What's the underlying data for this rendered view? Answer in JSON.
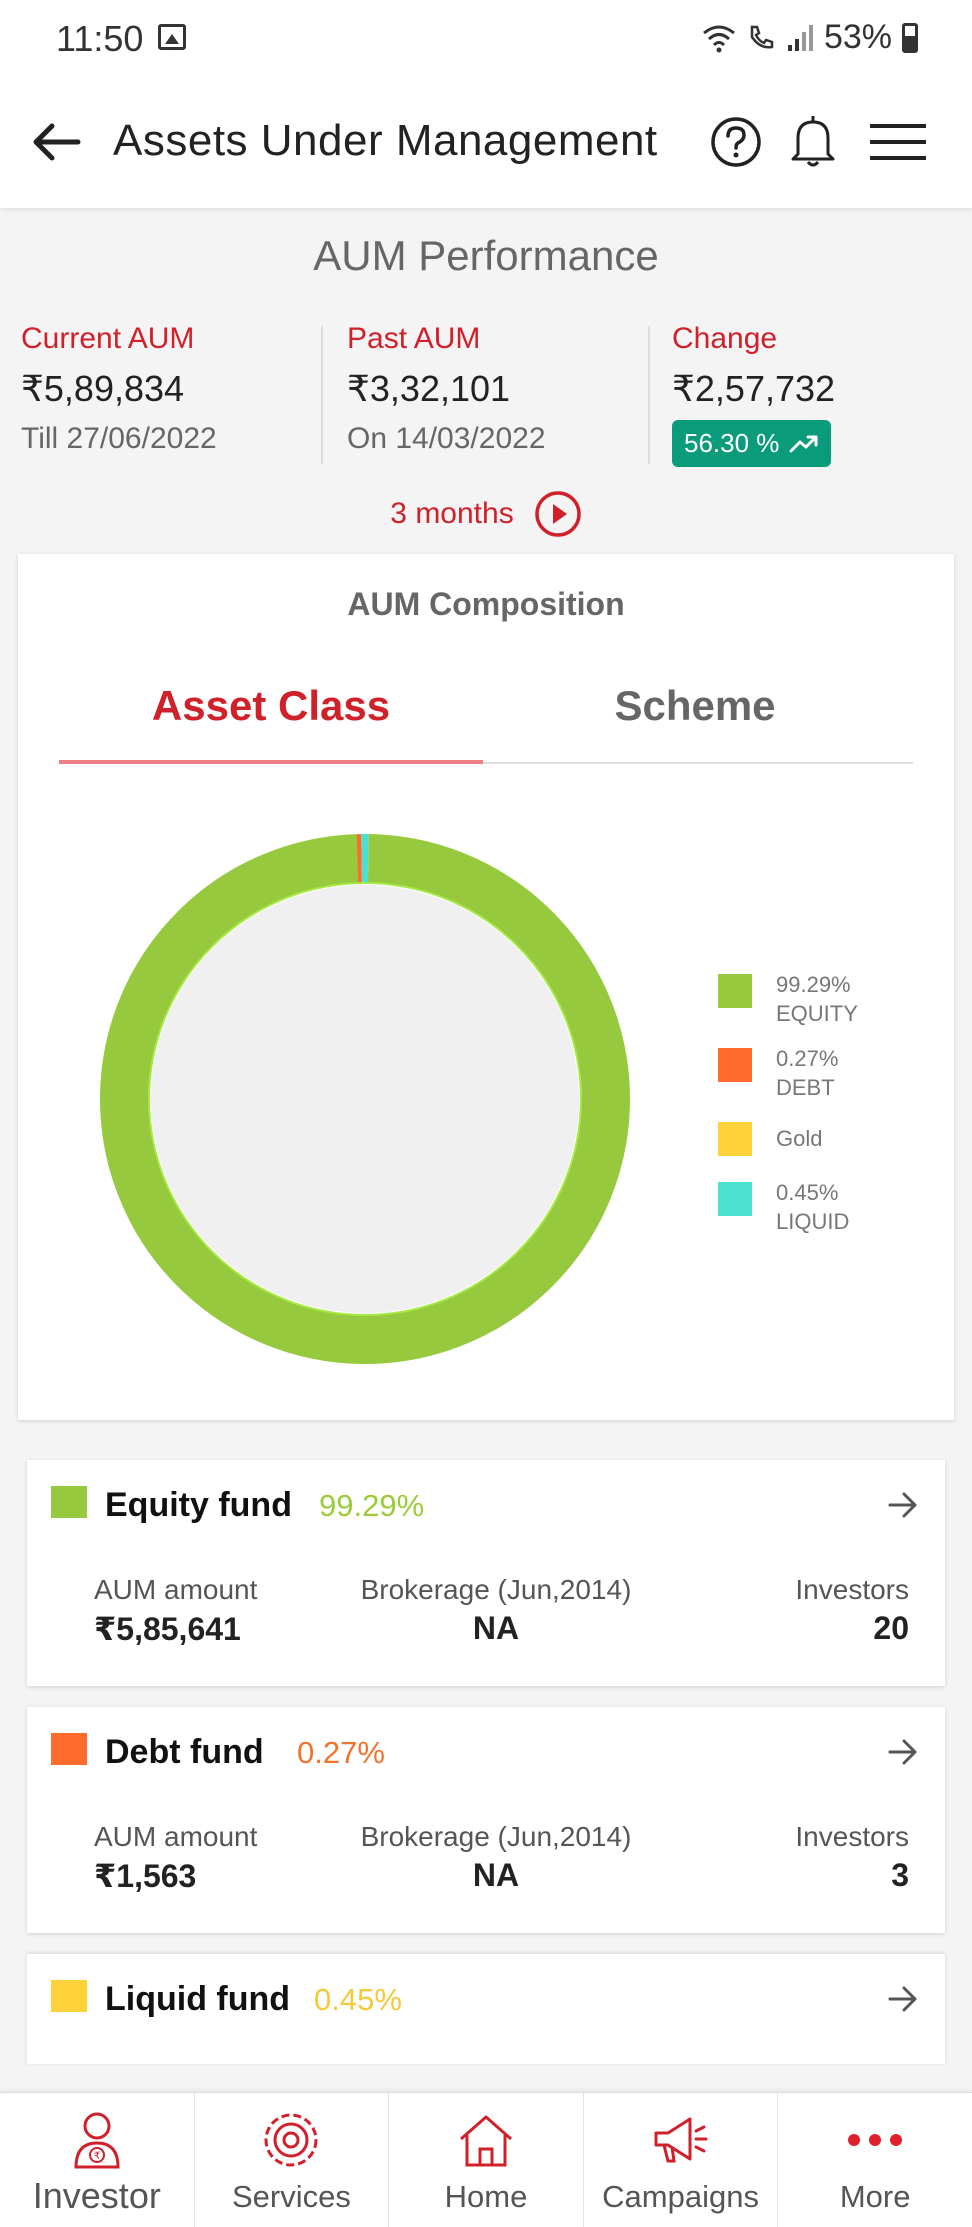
{
  "status_bar": {
    "time": "11:50",
    "battery": "53%"
  },
  "header": {
    "title": "Assets Under Management"
  },
  "performance": {
    "title": "AUM Performance",
    "current": {
      "label": "Current AUM",
      "amount": "₹5,89,834",
      "sub": "Till 27/06/2022"
    },
    "past": {
      "label": "Past AUM",
      "amount": "₹3,32,101",
      "sub": "On 14/03/2022"
    },
    "change": {
      "label": "Change",
      "amount": "₹2,57,732",
      "badge": "56.30 %"
    },
    "period": "3 months"
  },
  "composition": {
    "title": "AUM Composition",
    "tabs": [
      {
        "label": "Asset Class",
        "active": true
      },
      {
        "label": "Scheme",
        "active": false
      }
    ],
    "legend": [
      {
        "pct": "99.29%",
        "name": "EQUITY",
        "color": "#96c93d"
      },
      {
        "pct": "0.27%",
        "name": "DEBT",
        "color": "#ff6b2c"
      },
      {
        "pct": "",
        "name": "Gold",
        "color": "#ffd23a"
      },
      {
        "pct": "0.45%",
        "name": "LIQUID",
        "color": "#4be0cf"
      }
    ]
  },
  "chart_data": {
    "type": "pie",
    "categories": [
      "EQUITY",
      "DEBT",
      "Gold",
      "LIQUID"
    ],
    "values": [
      99.29,
      0.27,
      0,
      0.45
    ],
    "colors": [
      "#96c93d",
      "#ff6b2c",
      "#ffd23a",
      "#4be0cf"
    ],
    "legend": "right"
  },
  "funds": [
    {
      "name": "Equity fund",
      "pct": "99.29%",
      "color": "#96c93d",
      "pct_color": "#9ccc3a",
      "aum_label": "AUM amount",
      "aum": "₹5,85,641",
      "brokerage_label": "Brokerage (Jun,2014)",
      "brokerage": "NA",
      "investors_label": "Investors",
      "investors": "20"
    },
    {
      "name": "Debt fund",
      "pct": "0.27%",
      "color": "#ff6b2c",
      "pct_color": "#f0742c",
      "aum_label": "AUM amount",
      "aum": "₹1,563",
      "brokerage_label": "Brokerage (Jun,2014)",
      "brokerage": "NA",
      "investors_label": "Investors",
      "investors": "3"
    },
    {
      "name": "Liquid fund",
      "pct": "0.45%",
      "color": "#ffd23a",
      "pct_color": "#f6c93a"
    }
  ],
  "bottom_nav": [
    {
      "label": "Investor"
    },
    {
      "label": "Services"
    },
    {
      "label": "Home"
    },
    {
      "label": "Campaigns"
    },
    {
      "label": "More"
    }
  ]
}
